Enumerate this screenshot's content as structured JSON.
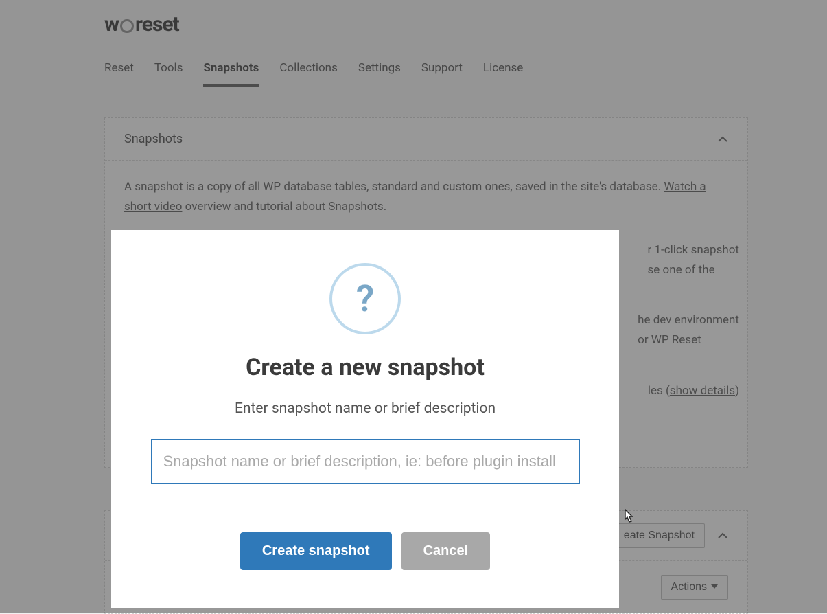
{
  "logo": {
    "prefix": "w",
    "suffix": "reset"
  },
  "tabs": [
    {
      "label": "Reset",
      "active": false
    },
    {
      "label": "Tools",
      "active": false
    },
    {
      "label": "Snapshots",
      "active": true
    },
    {
      "label": "Collections",
      "active": false
    },
    {
      "label": "Settings",
      "active": false
    },
    {
      "label": "Support",
      "active": false
    },
    {
      "label": "License",
      "active": false
    }
  ],
  "panel": {
    "title": "Snapshots",
    "desc_prefix": "A snapshot is a copy of all WP database tables, standard and custom ones, saved in the site's database. ",
    "video_link": "Watch a short video",
    "desc_suffix": " overview and tutorial about Snapshots.",
    "frag1a": "r 1-click snapshot",
    "frag1b": "se one of the",
    "frag2a": "he dev environment",
    "frag2b": "or WP Reset",
    "frag3_prefix": "les (",
    "frag3_link": "show details",
    "frag3_suffix": ")"
  },
  "list": {
    "create_button": "eate Snapshot",
    "actions_button": "Actions"
  },
  "modal": {
    "title": "Create a new snapshot",
    "subtitle": "Enter snapshot name or brief description",
    "placeholder": "Snapshot name or brief description, ie: before plugin install",
    "value": "",
    "confirm": "Create snapshot",
    "cancel": "Cancel"
  }
}
